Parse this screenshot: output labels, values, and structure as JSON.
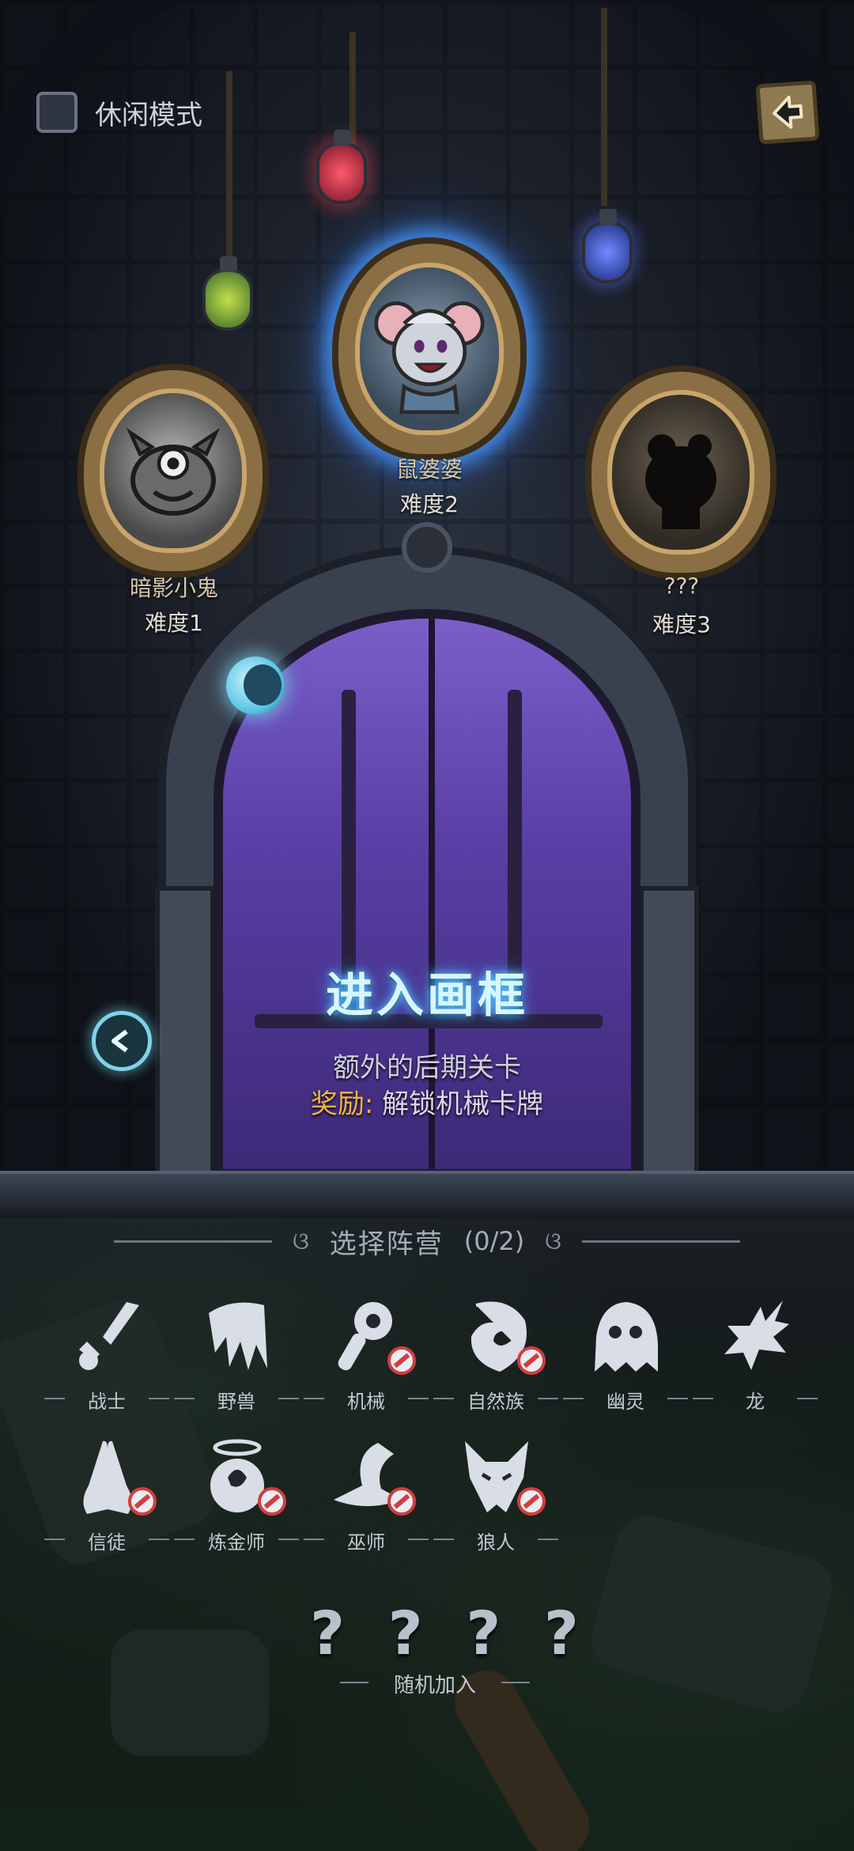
{
  "top_bar": {
    "casual_mode_label": "休闲模式"
  },
  "portraits": [
    {
      "name": "暗影小鬼",
      "difficulty": "难度1",
      "selected": false
    },
    {
      "name": "鼠婆婆",
      "difficulty": "难度2",
      "selected": true
    },
    {
      "name": "???",
      "difficulty": "难度3",
      "selected": false
    }
  ],
  "door": {
    "title": "进入画框",
    "description": "额外的后期关卡",
    "reward_key": "奖励:",
    "reward_value": "解锁机械卡牌"
  },
  "factions": {
    "title": "选择阵营",
    "count": "(0/2)",
    "items": [
      {
        "label": "战士",
        "icon": "sword-icon",
        "locked": false
      },
      {
        "label": "野兽",
        "icon": "claw-icon",
        "locked": false
      },
      {
        "label": "机械",
        "icon": "wrench-icon",
        "locked": true
      },
      {
        "label": "自然族",
        "icon": "nature-icon",
        "locked": true
      },
      {
        "label": "幽灵",
        "icon": "ghost-icon",
        "locked": false
      },
      {
        "label": "龙",
        "icon": "dragon-icon",
        "locked": false
      },
      {
        "label": "信徒",
        "icon": "praying-hands-icon",
        "locked": true
      },
      {
        "label": "炼金师",
        "icon": "cauldron-icon",
        "locked": true
      },
      {
        "label": "巫师",
        "icon": "wizard-hat-icon",
        "locked": true
      },
      {
        "label": "狼人",
        "icon": "wolf-icon",
        "locked": true
      }
    ]
  },
  "random": {
    "marks": [
      "?",
      "?",
      "?",
      "?"
    ],
    "label": "随机加入"
  },
  "colors": {
    "selected_glow": "#4696ff",
    "reward_accent": "#f1b646",
    "ban_red": "#d43c3c",
    "door_purple": "#7a5fc9"
  }
}
